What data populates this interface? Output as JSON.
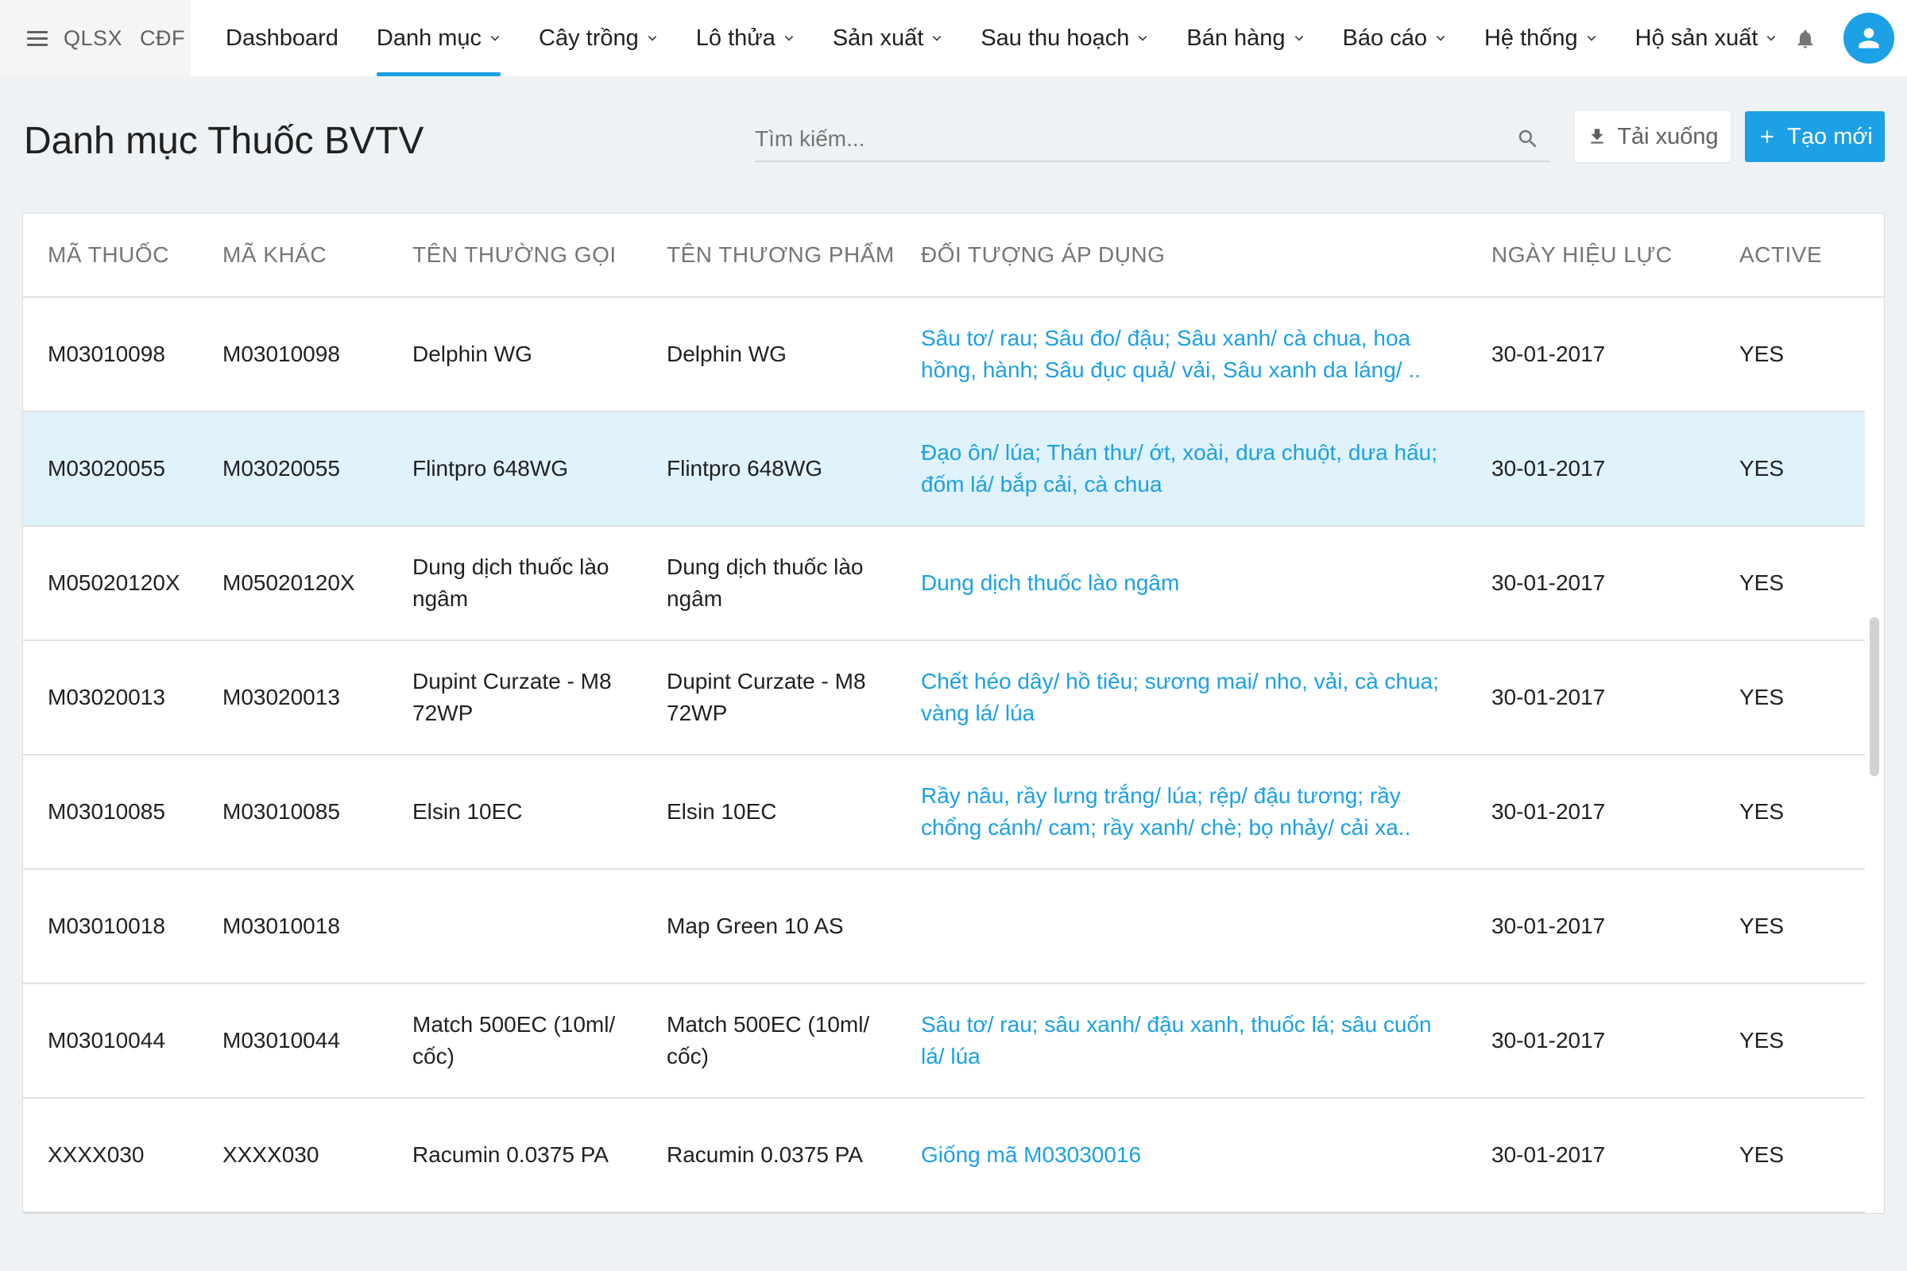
{
  "brand": {
    "left": "QLSX",
    "right": "CĐF"
  },
  "nav": [
    {
      "label": "Dashboard",
      "dropdown": false,
      "active": false
    },
    {
      "label": "Danh mục",
      "dropdown": true,
      "active": true
    },
    {
      "label": "Cây trồng",
      "dropdown": true,
      "active": false
    },
    {
      "label": "Lô thửa",
      "dropdown": true,
      "active": false
    },
    {
      "label": "Sản xuất",
      "dropdown": true,
      "active": false
    },
    {
      "label": "Sau thu hoạch",
      "dropdown": true,
      "active": false
    },
    {
      "label": "Bán hàng",
      "dropdown": true,
      "active": false
    },
    {
      "label": "Báo cáo",
      "dropdown": true,
      "active": false
    },
    {
      "label": "Hệ thống",
      "dropdown": true,
      "active": false
    },
    {
      "label": "Hộ sản xuất",
      "dropdown": true,
      "active": false
    }
  ],
  "page": {
    "title": "Danh mục Thuốc BVTV"
  },
  "search": {
    "placeholder": "Tìm kiếm..."
  },
  "actions": {
    "download_label": "Tải xuống",
    "create_label": "Tạo mới"
  },
  "colors": {
    "accent": "#1ca0e6",
    "selected_row": "#e0f2fb"
  },
  "table": {
    "columns": [
      "MÃ THUỐC",
      "MÃ KHÁC",
      "TÊN THƯỜNG GỌI",
      "TÊN THƯƠNG PHẨM",
      "ĐỐI TƯỢNG ÁP DỤNG",
      "NGÀY HIỆU LỰC",
      "ACTIVE"
    ],
    "rows": [
      {
        "ma_thuoc": "M03010098",
        "ma_khac": "M03010098",
        "ten_goi": "Delphin WG",
        "ten_thuong_pham": "Delphin WG",
        "doi_tuong": "Sâu tơ/ rau; Sâu đo/ đậu; Sâu xanh/ cà chua, hoa hồng, hành; Sâu đục quả/ vải, Sâu xanh da láng/ ..",
        "ngay": "30-01-2017",
        "active": "YES",
        "selected": false
      },
      {
        "ma_thuoc": "M03020055",
        "ma_khac": "M03020055",
        "ten_goi": "Flintpro 648WG",
        "ten_thuong_pham": "Flintpro 648WG",
        "doi_tuong": "Đạo ôn/ lúa; Thán thư/ ớt, xoài, dưa chuột, dưa hấu; đốm lá/ bắp cải, cà chua",
        "ngay": "30-01-2017",
        "active": "YES",
        "selected": true
      },
      {
        "ma_thuoc": "M05020120X",
        "ma_khac": "M05020120X",
        "ten_goi": "Dung dịch thuốc lào ngâm",
        "ten_thuong_pham": "Dung dịch thuốc lào ngâm",
        "doi_tuong": "Dung dịch thuốc lào ngâm",
        "ngay": "30-01-2017",
        "active": "YES",
        "selected": false
      },
      {
        "ma_thuoc": "M03020013",
        "ma_khac": "M03020013",
        "ten_goi": "Dupint Curzate - M8 72WP",
        "ten_thuong_pham": "Dupint Curzate - M8 72WP",
        "doi_tuong": "Chết héo dây/ hồ tiêu; sương mai/ nho, vải, cà chua; vàng lá/ lúa",
        "ngay": "30-01-2017",
        "active": "YES",
        "selected": false
      },
      {
        "ma_thuoc": "M03010085",
        "ma_khac": "M03010085",
        "ten_goi": "Elsin 10EC",
        "ten_thuong_pham": "Elsin 10EC",
        "doi_tuong": "Rầy nâu, rầy lưng trắng/ lúa; rệp/ đậu tương; rầy chổng cánh/ cam; rầy xanh/ chè; bọ nhảy/ cải xa..",
        "ngay": "30-01-2017",
        "active": "YES",
        "selected": false
      },
      {
        "ma_thuoc": "M03010018",
        "ma_khac": "M03010018",
        "ten_goi": "",
        "ten_thuong_pham": "Map Green 10 AS",
        "doi_tuong": "",
        "ngay": "30-01-2017",
        "active": "YES",
        "selected": false
      },
      {
        "ma_thuoc": "M03010044",
        "ma_khac": "M03010044",
        "ten_goi": "Match 500EC (10ml/ cốc)",
        "ten_thuong_pham": "Match 500EC (10ml/ cốc)",
        "doi_tuong": "Sâu tơ/ rau; sâu xanh/ đậu xanh, thuốc lá; sâu cuốn lá/ lúa",
        "ngay": "30-01-2017",
        "active": "YES",
        "selected": false
      },
      {
        "ma_thuoc": "XXXX030",
        "ma_khac": "XXXX030",
        "ten_goi": "Racumin 0.0375 PA",
        "ten_thuong_pham": "Racumin 0.0375 PA",
        "doi_tuong": "Giống mã M03030016",
        "ngay": "30-01-2017",
        "active": "YES",
        "selected": false
      }
    ]
  }
}
